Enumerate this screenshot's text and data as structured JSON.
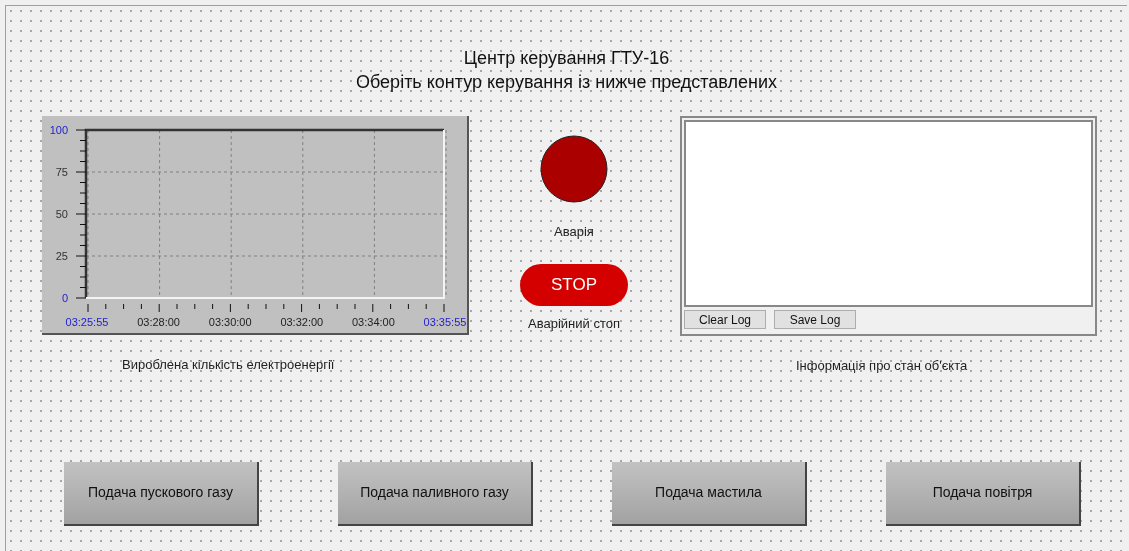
{
  "header": {
    "title": "Центр керування ГТУ-16",
    "subtitle": "Оберіть контур керування із нижче представлених"
  },
  "chart": {
    "caption": "Вироблена кількість електроенергії",
    "chart_data": {
      "type": "line",
      "categories": [
        "03:25:55",
        "03:28:00",
        "03:30:00",
        "03:32:00",
        "03:34:00",
        "03:35:55"
      ],
      "ylim": [
        0,
        100
      ],
      "yticks": [
        0,
        25,
        50,
        75,
        100
      ],
      "grid": true,
      "series": [
        {
          "values": [
            null,
            null,
            null,
            null,
            null,
            null
          ]
        }
      ]
    }
  },
  "alarm": {
    "label": "Аварія"
  },
  "emergency_stop": {
    "label": "STOP",
    "caption": "Аварійний стоп"
  },
  "log": {
    "buttons": [
      "Clear Log",
      "Save Log"
    ],
    "caption": "Інформація про стан об'єкта"
  },
  "buttons": [
    "Подача пускового газу",
    "Подача паливного газу",
    "Подача мастила",
    "Подача повітря"
  ]
}
